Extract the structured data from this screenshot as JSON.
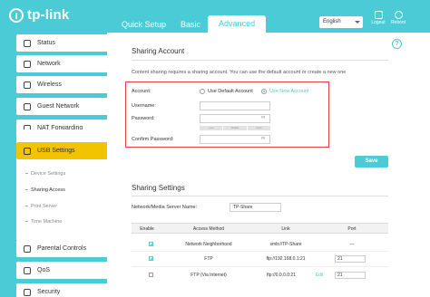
{
  "brand": {
    "name": "tp-link"
  },
  "header": {
    "tabs": [
      {
        "label": "Quick Setup"
      },
      {
        "label": "Basic"
      },
      {
        "label": "Advanced",
        "active": true
      }
    ],
    "language": "English",
    "logout_label": "Logout",
    "reboot_label": "Reboot"
  },
  "sidebar": {
    "items": [
      {
        "label": "Status",
        "icon": "status-icon"
      },
      {
        "label": "Network",
        "icon": "network-icon"
      },
      {
        "label": "Wireless",
        "icon": "wireless-icon"
      },
      {
        "label": "Guest Network",
        "icon": "guest-icon"
      },
      {
        "label": "NAT Forwarding",
        "icon": "nat-icon"
      },
      {
        "label": "USB Settings",
        "icon": "usb-icon",
        "active": true
      },
      {
        "label": "Parental Controls",
        "icon": "parental-icon"
      },
      {
        "label": "QoS",
        "icon": "qos-icon"
      },
      {
        "label": "Security",
        "icon": "security-icon"
      }
    ],
    "sub_items": [
      {
        "label": "Device Settings"
      },
      {
        "label": "Sharing Access",
        "active": true
      },
      {
        "label": "Print Server"
      },
      {
        "label": "Time Machine"
      }
    ]
  },
  "sharing_account": {
    "title": "Sharing Account",
    "description": "Content sharing requires a sharing account. You can use the default account or create a new one",
    "account_label": "Account:",
    "option_default": "Use Default Account",
    "option_new": "Use New Account",
    "selected": "new",
    "username_label": "Username:",
    "password_label": "Password:",
    "confirm_label": "Confirm Password:",
    "strength_levels": [
      "Low",
      "Middle",
      "High"
    ],
    "save_label": "Save"
  },
  "sharing_settings": {
    "title": "Sharing Settings",
    "server_name_label": "Network/Media Server Name:",
    "server_name_value": "TP-Share",
    "columns": [
      "Enable",
      "Access Method",
      "Link",
      "Port"
    ],
    "rows": [
      {
        "enabled": true,
        "method": "Network Neighborhood",
        "link": "smb://TP-Share",
        "port": "---"
      },
      {
        "enabled": true,
        "method": "FTP",
        "link": "ftp://192.168.0.1:21",
        "port": "21"
      },
      {
        "enabled": false,
        "method": "FTP (Via Internet)",
        "link": "ftp://0.0.0.0:21",
        "link_action": "Edit",
        "port": "21"
      }
    ]
  },
  "colors": {
    "accent": "#4acbd6",
    "active_nav": "#f3c300",
    "highlight_border": "#e0434b"
  }
}
